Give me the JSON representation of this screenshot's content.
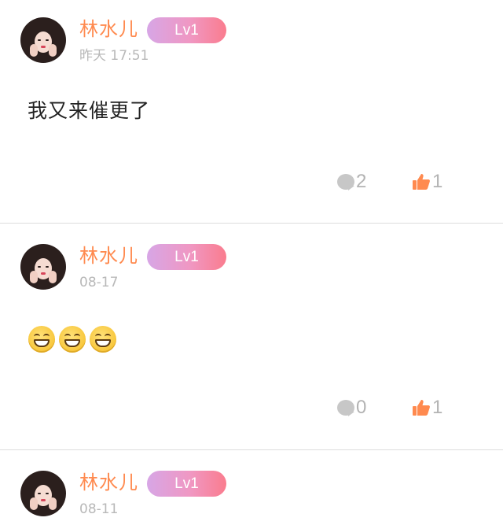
{
  "posts": [
    {
      "username": "林水儿",
      "level": "Lv1",
      "timestamp": "昨天 17:51",
      "content": "我又来催更了",
      "emojis": [],
      "comment_count": "2",
      "like_count": "1"
    },
    {
      "username": "林水儿",
      "level": "Lv1",
      "timestamp": "08-17",
      "content": "",
      "emojis": [
        "grinning-face",
        "grinning-face",
        "grinning-face"
      ],
      "comment_count": "0",
      "like_count": "1"
    },
    {
      "username": "林水儿",
      "level": "Lv1",
      "timestamp": "08-11"
    }
  ],
  "icons": {
    "comment": "comment-bubble-icon",
    "like": "thumbs-up-icon"
  },
  "colors": {
    "username": "#ff8a4f",
    "badge_gradient_start": "#d7a6e6",
    "badge_gradient_end": "#fa7c8e",
    "like_icon": "#ff8a4f",
    "muted": "#b3b3b3"
  }
}
